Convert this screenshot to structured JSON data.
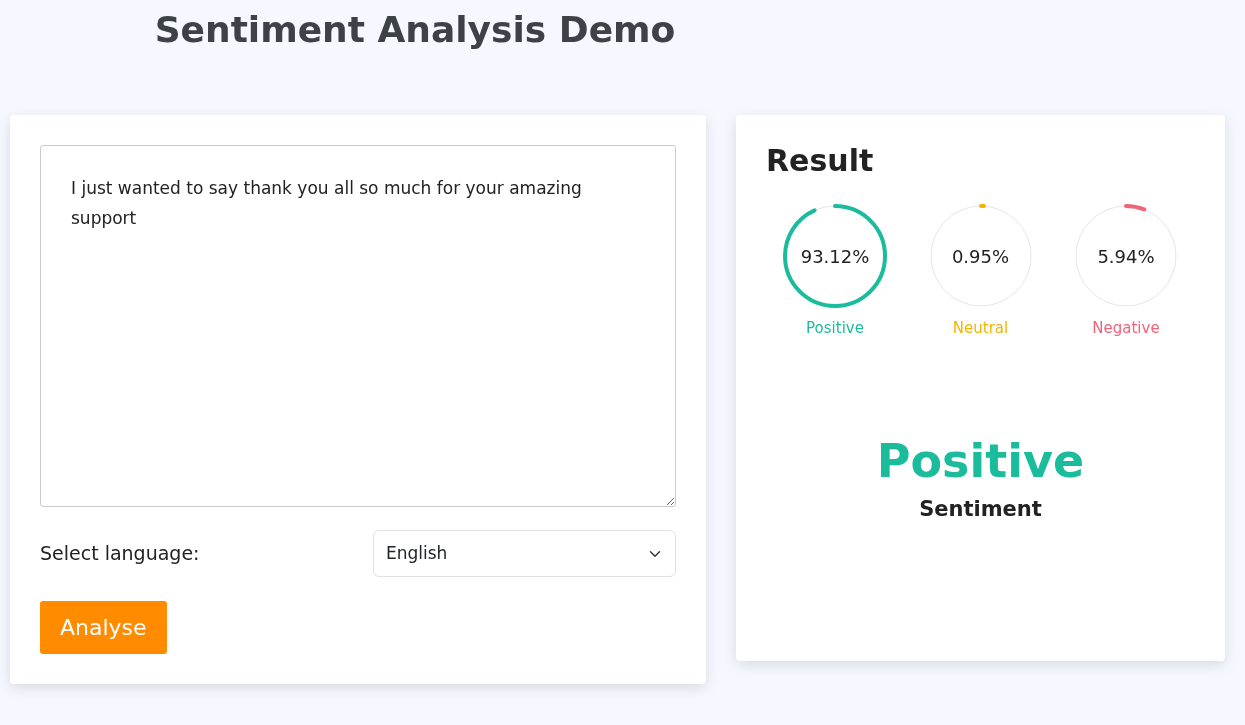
{
  "title": "Sentiment Analysis Demo",
  "input": {
    "value": "I just wanted to say thank you all so much for your amazing support"
  },
  "language": {
    "label": "Select language:",
    "value": "English"
  },
  "analyse_button": "Analyse",
  "result": {
    "heading": "Result",
    "scores": [
      {
        "label": "Positive",
        "reading": "93.12%",
        "level": 0.9312,
        "color": "#1abc9c"
      },
      {
        "label": "Neutral",
        "reading": "0.95%",
        "level": 0.0095,
        "color": "#f5b400"
      },
      {
        "label": "Negative",
        "reading": "5.94%",
        "level": 0.0594,
        "color": "#f0647a"
      }
    ],
    "sentiment": {
      "value": "Positive",
      "label": "Sentiment"
    }
  }
}
